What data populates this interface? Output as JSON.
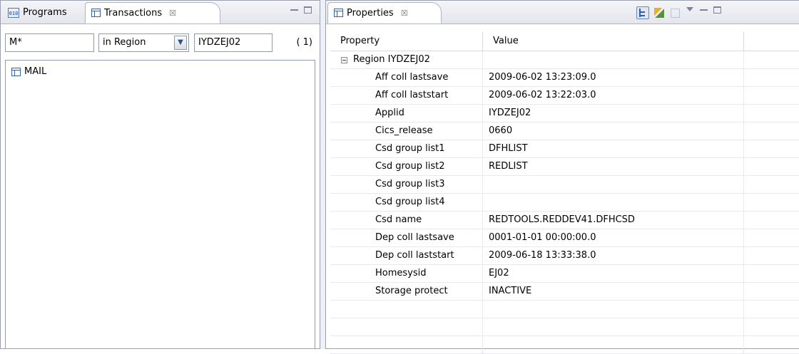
{
  "left_panel": {
    "tabs": [
      {
        "label": "Programs",
        "icon": "programs-icon"
      },
      {
        "label": "Transactions",
        "icon": "table-icon",
        "close": "☒"
      }
    ],
    "filter": {
      "name_value": "M*",
      "scope_value": "in Region",
      "scope_dropdown_glyph": "▼",
      "region_value": "IYDZEJ02",
      "count": "( 1)"
    },
    "tree_items": [
      {
        "label": "MAIL",
        "icon": "table-icon"
      }
    ]
  },
  "right_panel": {
    "tab": {
      "label": "Properties",
      "icon": "table-icon",
      "close": "☒"
    },
    "table": {
      "headers": {
        "property": "Property",
        "value": "Value"
      },
      "group": {
        "label": "Region IYDZEJ02"
      },
      "rows": [
        {
          "property": "Aff coll lastsave",
          "value": "2009-06-02 13:23:09.0"
        },
        {
          "property": "Aff coll laststart",
          "value": "2009-06-02 13:22:03.0"
        },
        {
          "property": "Applid",
          "value": "IYDZEJ02"
        },
        {
          "property": "Cics_release",
          "value": "0660"
        },
        {
          "property": "Csd group list1",
          "value": "DFHLIST"
        },
        {
          "property": "Csd group list2",
          "value": "REDLIST"
        },
        {
          "property": "Csd group list3",
          "value": ""
        },
        {
          "property": "Csd group list4",
          "value": ""
        },
        {
          "property": "Csd name",
          "value": "REDTOOLS.REDDEV41.DFHCSD"
        },
        {
          "property": "Dep coll lastsave",
          "value": "0001-01-01 00:00:00.0"
        },
        {
          "property": "Dep coll laststart",
          "value": "2009-06-18 13:33:38.0"
        },
        {
          "property": "Homesysid",
          "value": "EJ02"
        },
        {
          "property": "Storage protect",
          "value": "INACTIVE"
        },
        {
          "property": "",
          "value": ""
        },
        {
          "property": "",
          "value": ""
        },
        {
          "property": "",
          "value": ""
        }
      ]
    }
  }
}
